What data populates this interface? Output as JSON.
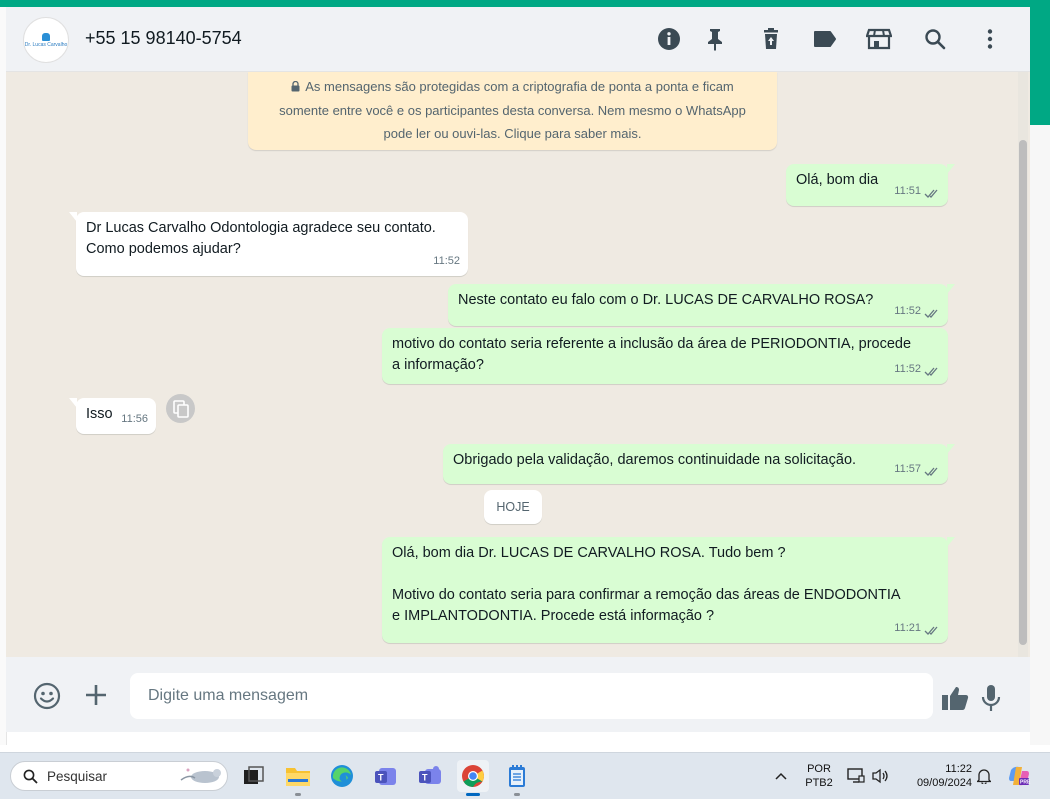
{
  "header": {
    "contact_name": "+55 15 98140-5754",
    "avatar_text": "Dr. Lucas Carvalho",
    "icons": [
      "info-icon",
      "pin-icon",
      "delete-icon",
      "label-icon",
      "store-icon",
      "search-icon",
      "menu-icon"
    ]
  },
  "encryption_notice": {
    "line1": "As mensagens são protegidas com a criptografia de ponta a ponta e ficam",
    "line2": "somente entre você e os participantes desta conversa. Nem mesmo o WhatsApp",
    "line3": "pode ler ou ouvi-las. Clique para saber mais."
  },
  "messages": [
    {
      "dir": "out",
      "lines": [
        "Olá, bom dia"
      ],
      "time": "11:51",
      "read": true
    },
    {
      "dir": "in",
      "lines": [
        "Dr Lucas Carvalho Odontologia agradece seu contato.",
        "Como podemos ajudar?"
      ],
      "time": "11:52"
    },
    {
      "dir": "out",
      "lines": [
        "Neste contato eu falo com o Dr. LUCAS DE CARVALHO ROSA?"
      ],
      "time": "11:52",
      "read": true
    },
    {
      "dir": "out",
      "lines": [
        "motivo do contato seria referente a inclusão da área de PERIODONTIA, procede",
        "a informação?"
      ],
      "time": "11:52",
      "read": true
    },
    {
      "dir": "in",
      "lines": [
        "Isso"
      ],
      "time": "11:56"
    },
    {
      "dir": "out",
      "lines": [
        "Obrigado pela validação, daremos continuidade na solicitação."
      ],
      "time": "11:57",
      "read": true
    },
    {
      "dir": "out",
      "lines": [
        "Olá, bom dia Dr. LUCAS DE CARVALHO ROSA. Tudo bem ?",
        "",
        "Motivo do contato seria para confirmar a remoção das áreas de ENDODONTIA",
        "e IMPLANTODONTIA. Procede está informação ?"
      ],
      "time": "11:21",
      "read": true
    }
  ],
  "date_divider": "HOJE",
  "composer": {
    "placeholder": "Digite uma mensagem"
  },
  "taskbar": {
    "search_label": "Pesquisar",
    "language_line1": "POR",
    "language_line2": "PTB2",
    "clock_time": "11:22",
    "clock_date": "09/09/2024",
    "apps": [
      "task-view",
      "file-explorer",
      "edge",
      "teams-personal",
      "teams-work",
      "chrome",
      "notepad"
    ]
  },
  "colors": {
    "accent": "#00a884",
    "outgoing_bubble": "#d9fdd3",
    "incoming_bubble": "#ffffff",
    "encryption_bg": "#ffeecd",
    "read_ticks": "#53bdeb"
  }
}
